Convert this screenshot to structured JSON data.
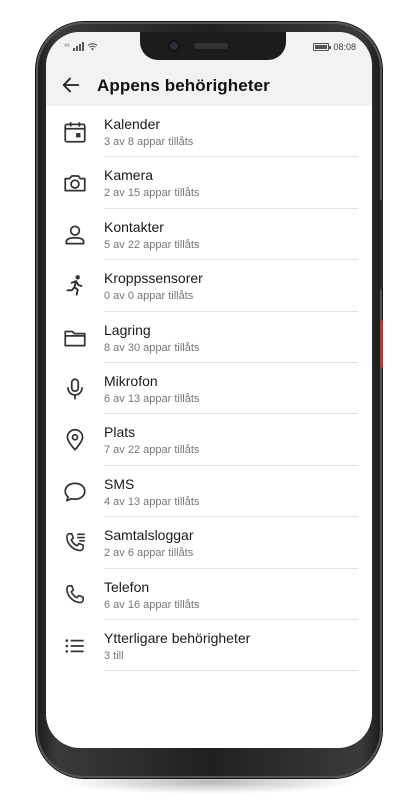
{
  "status_bar": {
    "signal_label": "⁴⁶",
    "time": "08:08"
  },
  "appbar": {
    "back_icon": "arrow-left-icon",
    "title": "Appens behörigheter"
  },
  "permissions": [
    {
      "label": "Kalender",
      "subtitle": "3 av 8 appar tillåts",
      "icon": "calendar-icon"
    },
    {
      "label": "Kamera",
      "subtitle": "2 av 15 appar tillåts",
      "icon": "camera-icon"
    },
    {
      "label": "Kontakter",
      "subtitle": "5 av 22 appar tillåts",
      "icon": "person-icon"
    },
    {
      "label": "Kroppssensorer",
      "subtitle": "0 av 0 appar tillåts",
      "icon": "running-icon"
    },
    {
      "label": "Lagring",
      "subtitle": "8 av 30 appar tillåts",
      "icon": "folder-icon"
    },
    {
      "label": "Mikrofon",
      "subtitle": "6 av 13 appar tillåts",
      "icon": "microphone-icon"
    },
    {
      "label": "Plats",
      "subtitle": "7 av 22 appar tillåts",
      "icon": "location-pin-icon"
    },
    {
      "label": "SMS",
      "subtitle": "4 av 13 appar tillåts",
      "icon": "chat-bubble-icon"
    },
    {
      "label": "Samtalsloggar",
      "subtitle": "2 av 6 appar tillåts",
      "icon": "call-log-icon"
    },
    {
      "label": "Telefon",
      "subtitle": "6 av 16 appar tillåts",
      "icon": "phone-icon"
    },
    {
      "label": "Ytterligare behörigheter",
      "subtitle": "3 till",
      "icon": "list-icon"
    }
  ],
  "colors": {
    "appbar_bg": "#f2f2f2",
    "text_primary": "#1a1a1a",
    "text_secondary": "#777777",
    "power_button": "#c0392b"
  }
}
